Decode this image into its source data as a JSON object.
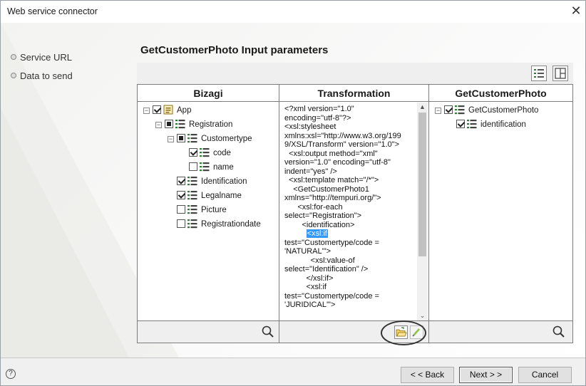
{
  "window": {
    "title": "Web service connector",
    "close_label": "✕"
  },
  "nav": {
    "items": [
      {
        "label": "Service URL"
      },
      {
        "label": "Data to send"
      }
    ]
  },
  "heading": "GetCustomerPhoto Input parameters",
  "panels": {
    "bizagi": {
      "title": "Bizagi",
      "tree": [
        {
          "label": "App",
          "level": 0,
          "expander": "−",
          "check": "checked",
          "icon": "xml-element-icon"
        },
        {
          "label": "Registration",
          "level": 1,
          "expander": "−",
          "check": "partial",
          "icon": "list-icon"
        },
        {
          "label": "Customertype",
          "level": 2,
          "expander": "−",
          "check": "partial",
          "icon": "list-icon"
        },
        {
          "label": "code",
          "level": 3,
          "expander": "",
          "check": "checked",
          "icon": "list-icon"
        },
        {
          "label": "name",
          "level": 3,
          "expander": "",
          "check": "unchecked",
          "icon": "list-icon"
        },
        {
          "label": "Identification",
          "level": 2,
          "expander": "",
          "check": "checked",
          "icon": "list-icon"
        },
        {
          "label": "Legalname",
          "level": 2,
          "expander": "",
          "check": "checked",
          "icon": "list-icon"
        },
        {
          "label": "Picture",
          "level": 2,
          "expander": "",
          "check": "unchecked",
          "icon": "list-icon"
        },
        {
          "label": "Registrationdate",
          "level": 2,
          "expander": "",
          "check": "unchecked",
          "icon": "list-icon"
        }
      ]
    },
    "transformation": {
      "title": "Transformation",
      "lines": [
        "<?xml version=\"1.0\"",
        "encoding=\"utf-8\"?>",
        "<xsl:stylesheet",
        "xmlns:xsl=\"http://www.w3.org/199",
        "9/XSL/Transform\" version=\"1.0\">",
        "  <xsl:output method=\"xml\"",
        "version=\"1.0\" encoding=\"utf-8\"",
        "indent=\"yes\" />",
        "  <xsl:template match=\"/*\">",
        "    <GetCustomerPhoto1",
        "xmlns=\"http://tempuri.org/\">",
        "      <xsl:for-each",
        "select=\"Registration\">",
        "        <identification>",
        "          <xsl:if",
        "test=\"Customertype/code =",
        "'NATURAL'\">",
        "            <xsl:value-of",
        "select=\"Identification\" />",
        "          </xsl:if>",
        "          <xsl:if",
        "test=\"Customertype/code =",
        "'JURIDICAL'\">"
      ],
      "selected_text": "<xsl:if"
    },
    "target": {
      "title": "GetCustomerPhoto",
      "tree": [
        {
          "label": "GetCustomerPhoto",
          "level": 0,
          "expander": "−",
          "check": "checked",
          "icon": "list-icon"
        },
        {
          "label": "identification",
          "level": 1,
          "expander": "",
          "check": "checked",
          "icon": "list-icon"
        }
      ]
    }
  },
  "buttons": {
    "back": "< < Back",
    "next": "Next > >",
    "cancel": "Cancel",
    "help": "?"
  },
  "colors": {
    "selection": "#3399ff",
    "panel_border": "#7d7d7d",
    "footer_bg": "#efefef"
  }
}
